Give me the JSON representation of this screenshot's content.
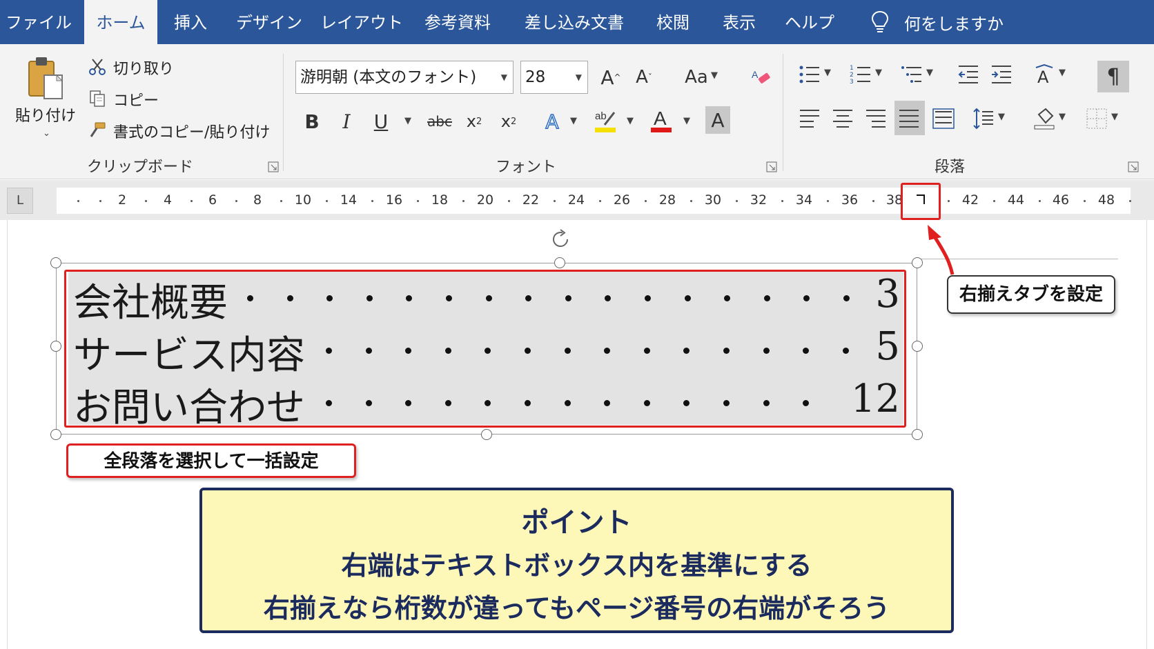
{
  "tabs": [
    {
      "label": "ファイル",
      "active": false
    },
    {
      "label": "ホーム",
      "active": true
    },
    {
      "label": "挿入",
      "active": false
    },
    {
      "label": "デザイン",
      "active": false
    },
    {
      "label": "レイアウト",
      "active": false
    },
    {
      "label": "参考資料",
      "active": false
    },
    {
      "label": "差し込み文書",
      "active": false
    },
    {
      "label": "校閲",
      "active": false
    },
    {
      "label": "表示",
      "active": false
    },
    {
      "label": "ヘルプ",
      "active": false
    }
  ],
  "tell_me": {
    "label": "何をしますか",
    "icon": "lightbulb-icon"
  },
  "clipboard": {
    "paste_label": "貼り付け",
    "cut_label": "切り取り",
    "copy_label": "コピー",
    "format_painter_label": "書式のコピー/貼り付け",
    "group_label": "クリップボード"
  },
  "font": {
    "name": "游明朝 (本文のフォント)",
    "size": "28",
    "change_case": "Aa",
    "bold": "B",
    "italic": "I",
    "underline": "U",
    "strike": "abc",
    "group_label": "フォント"
  },
  "paragraph": {
    "group_label": "段落",
    "pilcrow": "¶"
  },
  "ruler": {
    "corner": "L",
    "numbers": [
      "2",
      "4",
      "6",
      "8",
      "10",
      "14",
      "16",
      "18",
      "20",
      "22",
      "24",
      "26",
      "28",
      "30",
      "32",
      "34",
      "36",
      "38",
      "42",
      "44",
      "46",
      "48"
    ]
  },
  "toc": [
    {
      "title": "会社概要",
      "page": "3"
    },
    {
      "title": "サービス内容",
      "page": "5"
    },
    {
      "title": "お問い合わせ",
      "page": "12"
    }
  ],
  "callouts": {
    "right_tab": "右揃えタブを設定",
    "all_paragraphs": "全段落を選択して一括設定"
  },
  "point": {
    "title": "ポイント",
    "line1": "右端はテキストボックス内を基準にする",
    "line2": "右揃えなら桁数が違ってもページ番号の右端がそろう"
  },
  "colors": {
    "ribbon_blue": "#2b579a",
    "highlight_red": "#e02020",
    "point_bg": "#fdf7b8",
    "point_text": "#1b2b5e"
  }
}
